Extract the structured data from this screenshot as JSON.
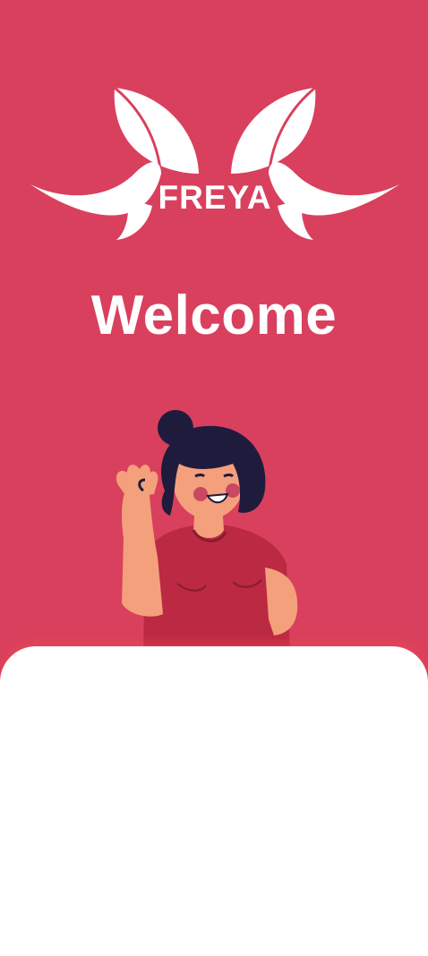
{
  "brand": {
    "name": "FREYA",
    "logo_icon": "freya-wings-logo"
  },
  "welcome": {
    "title": "Welcome"
  },
  "illustration": {
    "icon": "waving-woman-illustration"
  },
  "colors": {
    "background": "#d9405d",
    "sheet": "#ffffff",
    "text": "#ffffff"
  }
}
